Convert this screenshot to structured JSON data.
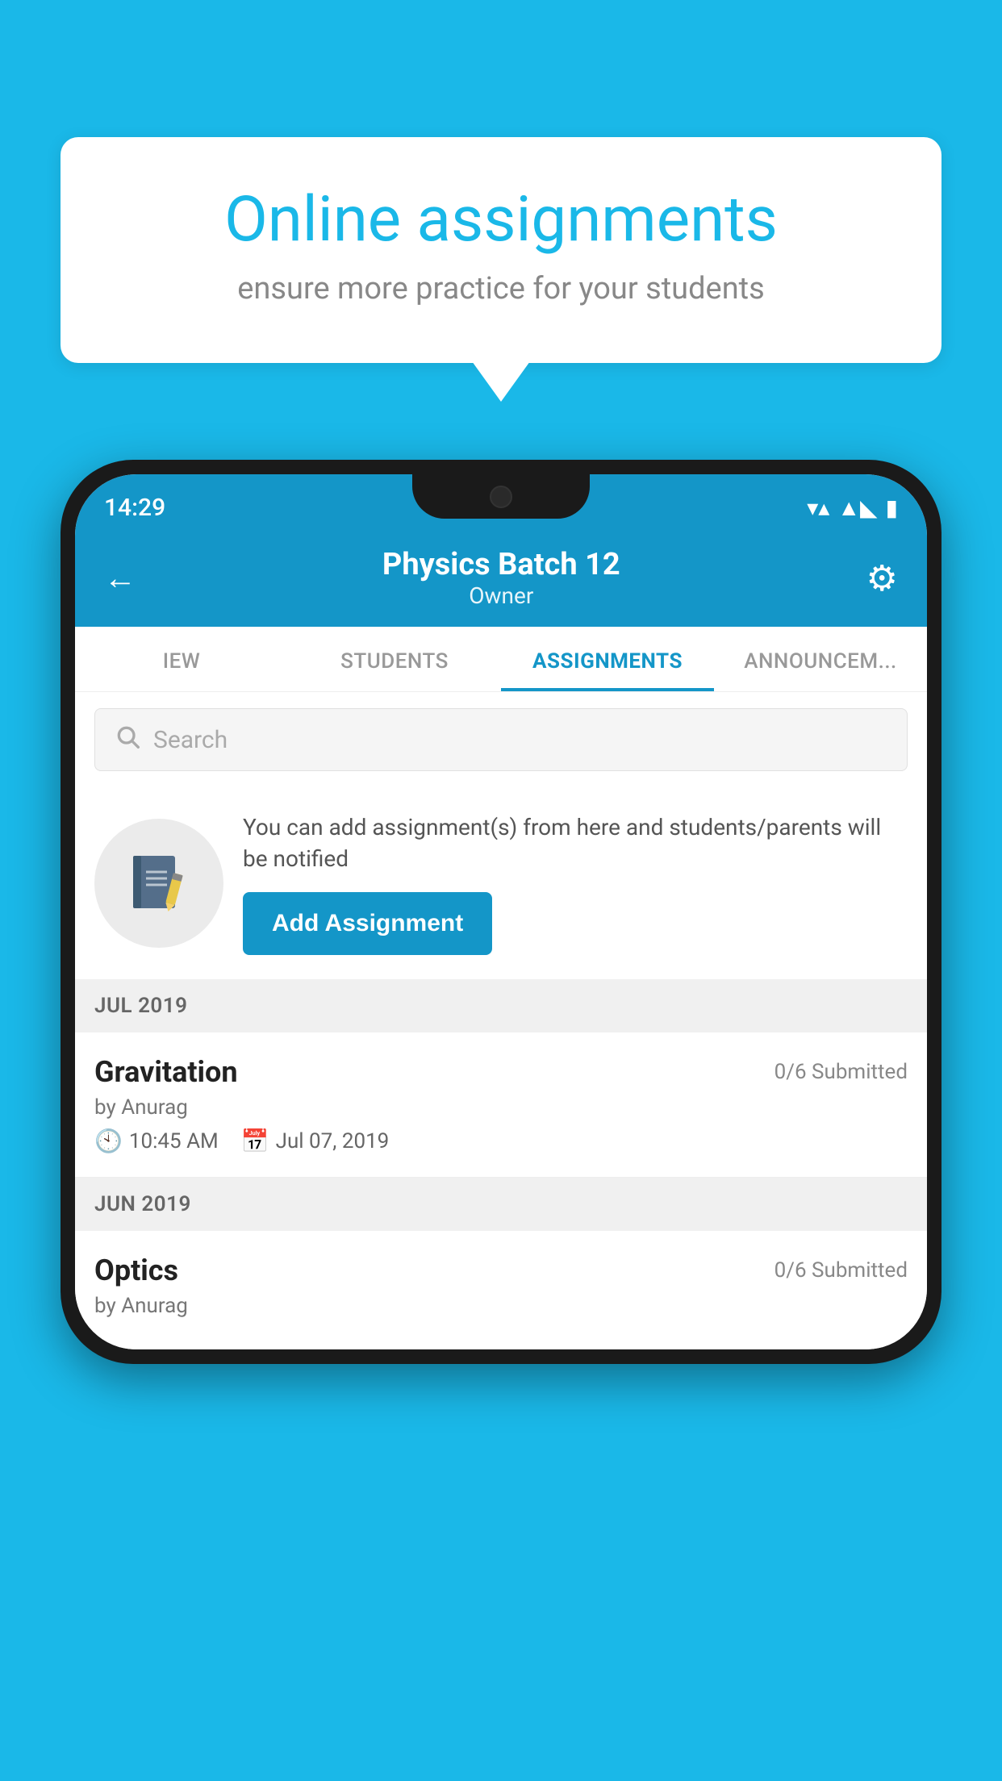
{
  "background": {
    "color": "#1ab8e8"
  },
  "speech_bubble": {
    "title": "Online assignments",
    "subtitle": "ensure more practice for your students"
  },
  "status_bar": {
    "time": "14:29",
    "wifi": "▲",
    "signal": "▲",
    "battery": "▮"
  },
  "header": {
    "title": "Physics Batch 12",
    "subtitle": "Owner",
    "back_label": "←",
    "settings_label": "⚙"
  },
  "tabs": [
    {
      "label": "IEW",
      "active": false
    },
    {
      "label": "STUDENTS",
      "active": false
    },
    {
      "label": "ASSIGNMENTS",
      "active": true
    },
    {
      "label": "ANNOUNCEM...",
      "active": false
    }
  ],
  "search": {
    "placeholder": "Search"
  },
  "assignment_promo": {
    "description": "You can add assignment(s) from here and students/parents will be notified",
    "button_label": "Add Assignment"
  },
  "sections": [
    {
      "label": "JUL 2019",
      "assignments": [
        {
          "name": "Gravitation",
          "submitted": "0/6 Submitted",
          "by": "by Anurag",
          "time": "10:45 AM",
          "date": "Jul 07, 2019"
        }
      ]
    },
    {
      "label": "JUN 2019",
      "assignments": [
        {
          "name": "Optics",
          "submitted": "0/6 Submitted",
          "by": "by Anurag",
          "time": "",
          "date": ""
        }
      ]
    }
  ]
}
